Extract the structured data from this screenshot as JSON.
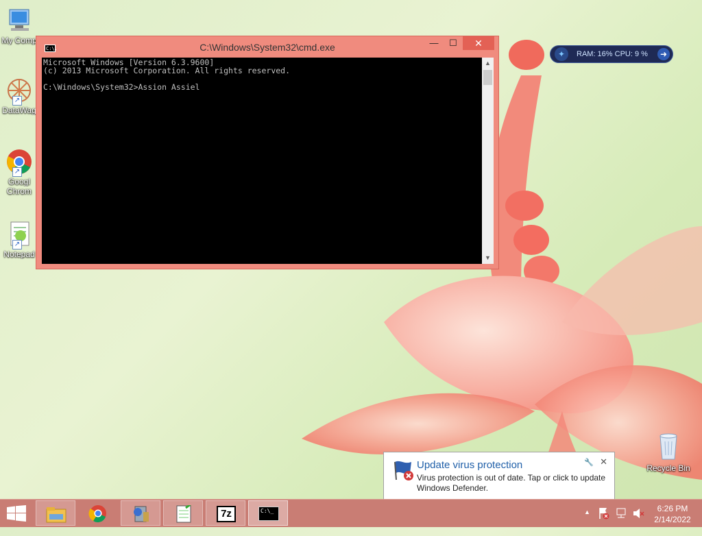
{
  "desktop": {
    "icons": [
      {
        "label": "My Comp"
      },
      {
        "label": "DataWag"
      },
      {
        "label": "Googl",
        "label2": "Chrom"
      },
      {
        "label": "Notepad"
      }
    ],
    "recycle_bin": {
      "label": "Recycle Bin"
    }
  },
  "cmd_window": {
    "title": "C:\\Windows\\System32\\cmd.exe",
    "icon_text": "C:\\.",
    "minimize": "—",
    "maximize": "☐",
    "close": "✕",
    "console_text": "Microsoft Windows [Version 6.3.9600]\n(c) 2013 Microsoft Corporation. All rights reserved.\n\nC:\\Windows\\System32>Assion Assiel"
  },
  "gadget": {
    "text": "RAM: 16%   CPU: 9 %",
    "arrow": "➜"
  },
  "notification": {
    "title": "Update virus protection",
    "body": "Virus protection is out of date. Tap or click to update Windows Defender.",
    "close": "✕"
  },
  "taskbar": {
    "apps": [
      {
        "name": "file-explorer"
      },
      {
        "name": "google-chrome"
      },
      {
        "name": "system-tool"
      },
      {
        "name": "notepad-plus-plus"
      },
      {
        "name": "7zip",
        "text": "7z"
      },
      {
        "name": "command-prompt",
        "text": "C:\\_"
      }
    ],
    "tray_up": "▲",
    "clock_time": "6:26 PM",
    "clock_date": "2/14/2022"
  },
  "colors": {
    "cmd_frame": "#f08b7e",
    "taskbar": "#c97d74",
    "notification_title": "#1f5fa8",
    "gadget_bg": "#1f2a55"
  }
}
